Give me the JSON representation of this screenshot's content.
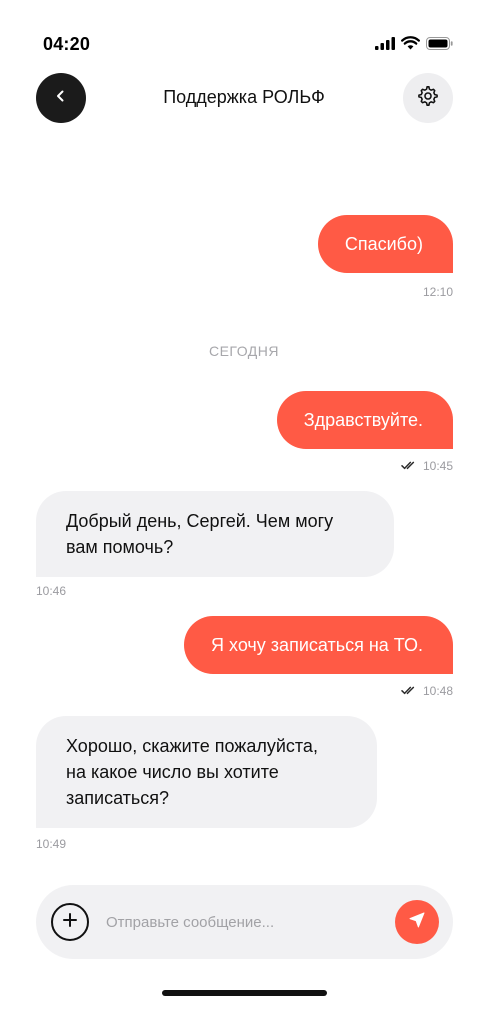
{
  "status_bar": {
    "time": "04:20",
    "icons": [
      "signal-icon",
      "wifi-icon",
      "battery-icon"
    ]
  },
  "header": {
    "back_icon": "chevron-left-icon",
    "title": "Поддержка РОЛЬФ",
    "settings_icon": "gear-icon"
  },
  "messages": [
    {
      "direction": "outgoing",
      "text": "Спасибо)",
      "time": "12:10",
      "read": false
    },
    {
      "direction": "outgoing",
      "text": "Здравствуйте.",
      "time": "10:45",
      "read": true
    },
    {
      "direction": "incoming",
      "lines": [
        "Добрый день, Сергей. Чем могу",
        "вам помочь?"
      ],
      "time": "10:46"
    },
    {
      "direction": "outgoing",
      "text": "Я хочу записаться на ТО.",
      "time": "10:48",
      "read": true
    },
    {
      "direction": "incoming",
      "lines": [
        "Хорошо, скажите пожалуйста,",
        "на какое число вы хотите",
        "записаться?"
      ],
      "time": "10:49"
    }
  ],
  "date_divider": "СЕГОДНЯ",
  "composer": {
    "attach_icon": "plus-icon",
    "placeholder": "Отправьте сообщение...",
    "value": "",
    "send_icon": "send-icon"
  },
  "colors": {
    "accent": "#FF5A45",
    "incoming_bubble": "#F1F1F3",
    "back_button": "#1B1B1B",
    "meta_text": "#9B9BA0"
  }
}
